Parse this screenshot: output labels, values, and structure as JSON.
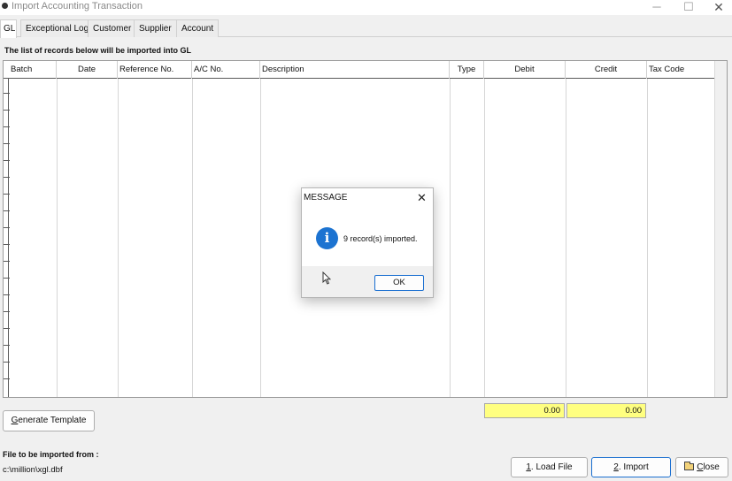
{
  "window": {
    "title": "Import Accounting Transaction",
    "minimize_glyph": "─",
    "maximize_glyph": "☐",
    "close_glyph": "✕"
  },
  "tabs": [
    {
      "label": "GL",
      "active": true
    },
    {
      "label": "Exceptional Log",
      "active": false
    },
    {
      "label": "Customer",
      "active": false
    },
    {
      "label": "Supplier",
      "active": false
    },
    {
      "label": "Account",
      "active": false
    }
  ],
  "grid": {
    "caption": "The list of records below will be imported into GL",
    "columns": [
      "Batch",
      "Date",
      "Reference No.",
      "A/C No.",
      "Description",
      "Type",
      "Debit",
      "Credit",
      "Tax Code"
    ],
    "rows": []
  },
  "totals": {
    "debit": "0.00",
    "credit": "0.00",
    "fill_color": "#ffff80"
  },
  "buttons": {
    "generate_template": {
      "mnemonic": "G",
      "rest": "enerate Template"
    },
    "load_file": {
      "mnemonic": "1",
      "rest": ". Load File"
    },
    "import": {
      "mnemonic": "2",
      "rest": ". Import"
    },
    "close": {
      "mnemonic": "C",
      "rest": "lose",
      "icon": "folder-icon"
    }
  },
  "file": {
    "label": "File to be imported from :",
    "path": "c:\\million\\xgl.dbf"
  },
  "dialog": {
    "title": "MESSAGE",
    "close_glyph": "✕",
    "icon": "info-icon",
    "icon_glyph": "i",
    "message": "9 record(s) imported.",
    "ok_label": "OK",
    "accent": "#1c73d1"
  }
}
